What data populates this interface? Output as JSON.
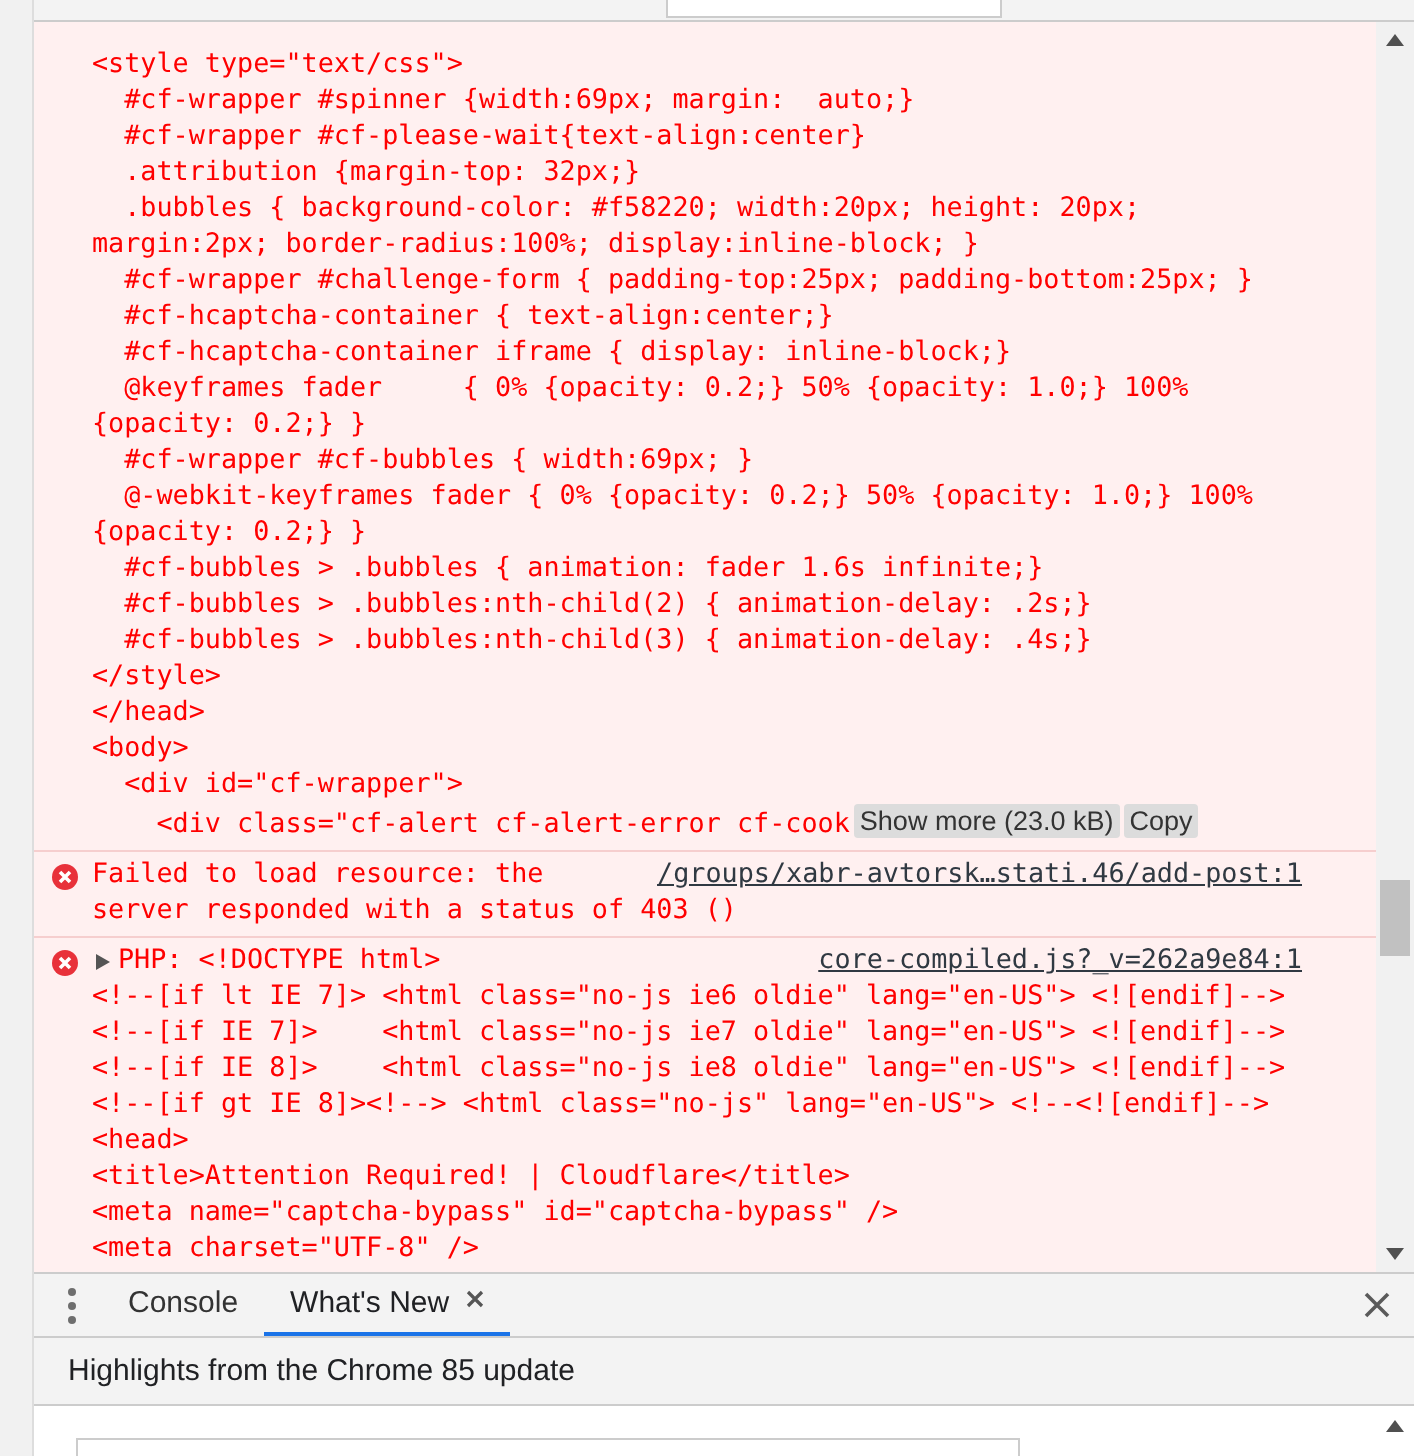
{
  "console": {
    "messages": [
      {
        "kind": "continuation",
        "lines": [
          "<style type=\"text/css\">",
          "  #cf-wrapper #spinner {width:69px; margin:  auto;}",
          "  #cf-wrapper #cf-please-wait{text-align:center}",
          "  .attribution {margin-top: 32px;}",
          "  .bubbles { background-color: #f58220; width:20px; height: 20px;",
          "margin:2px; border-radius:100%; display:inline-block; }",
          "  #cf-wrapper #challenge-form { padding-top:25px; padding-bottom:25px; }",
          "  #cf-hcaptcha-container { text-align:center;}",
          "  #cf-hcaptcha-container iframe { display: inline-block;}",
          "  @keyframes fader     { 0% {opacity: 0.2;} 50% {opacity: 1.0;} 100%",
          "{opacity: 0.2;} }",
          "  #cf-wrapper #cf-bubbles { width:69px; }",
          "  @-webkit-keyframes fader { 0% {opacity: 0.2;} 50% {opacity: 1.0;} 100%",
          "{opacity: 0.2;} }",
          "  #cf-bubbles > .bubbles { animation: fader 1.6s infinite;}",
          "  #cf-bubbles > .bubbles:nth-child(2) { animation-delay: .2s;}",
          "  #cf-bubbles > .bubbles:nth-child(3) { animation-delay: .4s;}",
          "</style>",
          "</head>",
          "<body>",
          "  <div id=\"cf-wrapper\">",
          "    <div class=\"cf-alert cf-alert-error cf-cook"
        ],
        "buttons": [
          "Show more (23.0 kB)",
          "Copy"
        ]
      },
      {
        "kind": "error",
        "lines": [
          "Failed to load resource: the",
          "server responded with a status of 403 ()"
        ],
        "source": "/groups/xabr-avtorsk…stati.46/add-post:1"
      },
      {
        "kind": "error",
        "expandable": true,
        "expanded": false,
        "head": "PHP: <!DOCTYPE html>",
        "source": "core-compiled.js?_v=262a9e84:1",
        "lines": [
          "<!--[if lt IE 7]> <html class=\"no-js ie6 oldie\" lang=\"en-US\"> <![endif]-->",
          "<!--[if IE 7]>    <html class=\"no-js ie7 oldie\" lang=\"en-US\"> <![endif]-->",
          "<!--[if IE 8]>    <html class=\"no-js ie8 oldie\" lang=\"en-US\"> <![endif]-->",
          "<!--[if gt IE 8]><!--> <html class=\"no-js\" lang=\"en-US\"> <!--<![endif]-->",
          "<head>",
          "<title>Attention Required! | Cloudflare</title>",
          "<meta name=\"captcha-bypass\" id=\"captcha-bypass\" />",
          "<meta charset=\"UTF-8\" />"
        ]
      }
    ]
  },
  "drawer": {
    "tabs": [
      {
        "label": "Console",
        "selected": false,
        "closable": false
      },
      {
        "label": "What's New",
        "selected": true,
        "closable": true
      }
    ]
  },
  "whats_new": {
    "title": "Highlights from the Chrome 85 update"
  }
}
